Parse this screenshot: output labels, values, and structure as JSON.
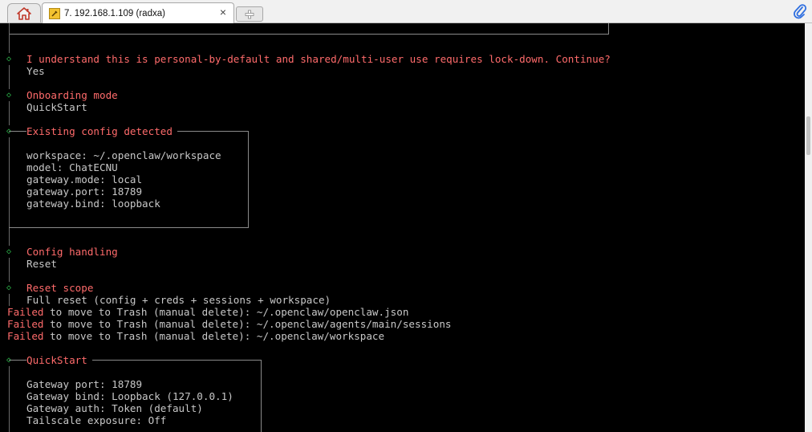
{
  "tabs": {
    "home_icon": "home-icon",
    "active_title": "7. 192.168.1.109 (radxa)",
    "close_label": "×",
    "tab_icon": "wrench-icon",
    "new_tab_icon": "plus-icon",
    "attach_icon": "paperclip-icon"
  },
  "terminal": {
    "confirm_question": "I understand this is personal-by-default and shared/multi-user use requires lock-down. Continue?",
    "confirm_answer": "Yes",
    "onboarding_title": "Onboarding mode",
    "onboarding_value": "QuickStart",
    "existing_title": "Existing config detected",
    "config_lines": [
      "workspace: ~/.openclaw/workspace",
      "model: ChatECNU",
      "gateway.mode: local",
      "gateway.port: 18789",
      "gateway.bind: loopback"
    ],
    "handling_title": "Config handling",
    "handling_value": "Reset",
    "scope_title": "Reset scope",
    "scope_value": "Full reset (config + creds + sessions + workspace)",
    "failed_word": "Failed",
    "failed_rest": [
      " to move to Trash (manual delete): ~/.openclaw/openclaw.json",
      " to move to Trash (manual delete): ~/.openclaw/agents/main/sessions",
      " to move to Trash (manual delete): ~/.openclaw/workspace"
    ],
    "quickstart_title": "QuickStart",
    "quickstart_lines": [
      "Gateway port: 18789",
      "Gateway bind: Loopback (127.0.0.1)",
      "Gateway auth: Token (default)",
      "Tailscale exposure: Off"
    ]
  },
  "colors": {
    "terminal_bg": "#000000",
    "prompt_red": "#ff6b6b",
    "diamond_green": "#2db84b",
    "text_gray": "#c8c8c8"
  }
}
